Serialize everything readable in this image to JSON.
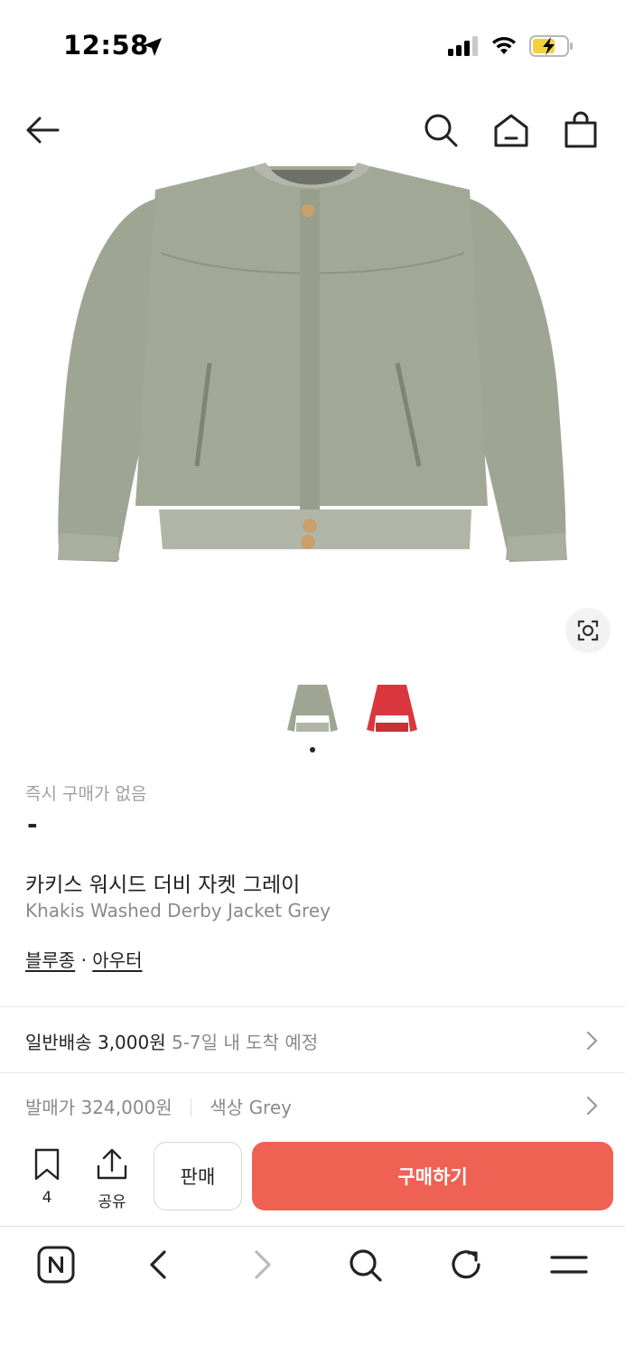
{
  "status_bar": {
    "time": "12:58"
  },
  "nav": {
    "back_icon": "back-arrow-icon",
    "search_icon": "search-icon",
    "home_icon": "home-icon",
    "cart_icon": "shopping-bag-icon"
  },
  "product": {
    "instant_label": "즉시 구매가 없음",
    "instant_price": "-",
    "name_ko": "카키스 워시드 더비 자켓 그레이",
    "name_en": "Khakis Washed Derby Jacket Grey",
    "category_1": "블루종",
    "separator": "·",
    "category_2": "아우터",
    "colors": {
      "grey": "#9ea593",
      "red": "#d9363e"
    }
  },
  "shipping": {
    "method": "일반배송",
    "fee": "3,000원",
    "eta": "5-7일 내 도착 예정"
  },
  "details": {
    "release_label": "발매가",
    "release_price": "324,000원",
    "color_label": "색상",
    "color_value": "Grey"
  },
  "actions": {
    "bookmark_count": "4",
    "share_label": "공유",
    "sell_label": "판매",
    "buy_label": "구매하기",
    "buy_color": "#ef6253"
  },
  "browser": {
    "home_icon": "naver-n-icon",
    "back_icon": "chevron-left-icon",
    "forward_icon": "chevron-right-icon",
    "search_icon": "search-icon",
    "reload_icon": "reload-icon",
    "menu_icon": "menu-icon"
  }
}
